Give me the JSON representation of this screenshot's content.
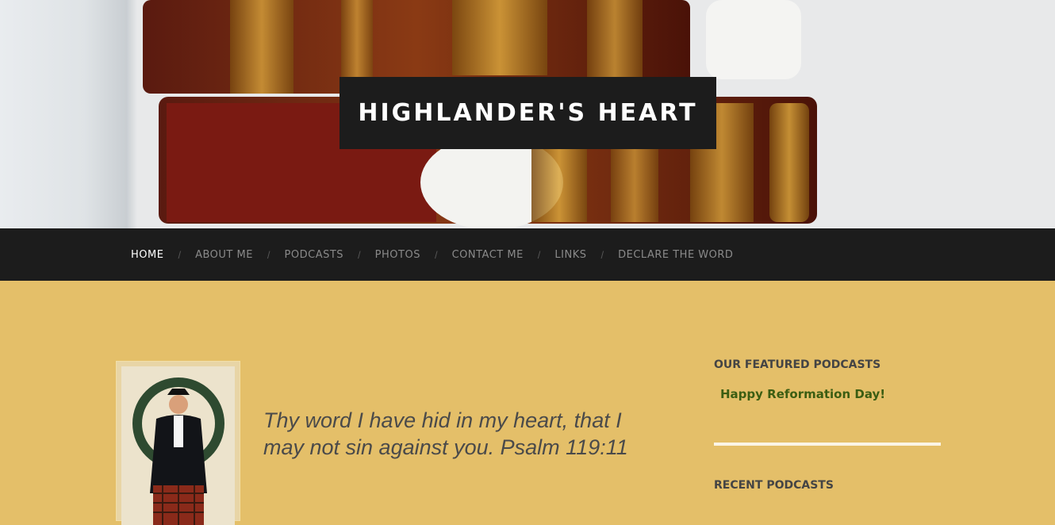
{
  "site": {
    "title": "HIGHLANDER'S HEART"
  },
  "nav": {
    "items": [
      {
        "label": "HOME",
        "active": true
      },
      {
        "label": "ABOUT ME"
      },
      {
        "label": "PODCASTS"
      },
      {
        "label": "PHOTOS"
      },
      {
        "label": "CONTACT ME"
      },
      {
        "label": "LINKS"
      },
      {
        "label": "DECLARE THE WORD"
      }
    ],
    "separator": "/"
  },
  "main": {
    "quote": "Thy word I have hid in my heart, that I may not sin against you. Psalm 119:11"
  },
  "sidebar": {
    "featured": {
      "title": "OUR FEATURED PODCASTS",
      "link": "Happy Reformation Day!"
    },
    "recent": {
      "title": "RECENT PODCASTS"
    }
  },
  "colors": {
    "background": "#e4bf69",
    "nav_bg": "#1c1c1c",
    "link": "#3b5d12"
  }
}
